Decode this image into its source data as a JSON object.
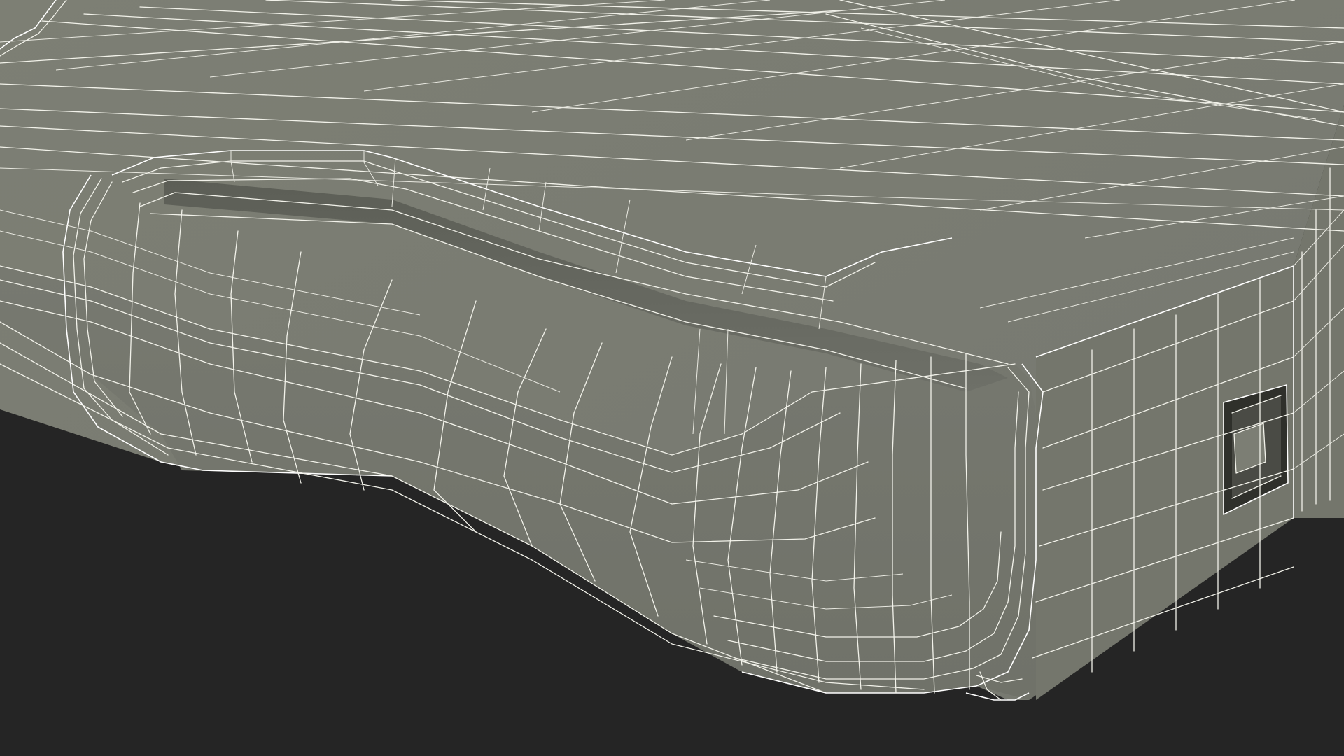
{
  "scene": {
    "subject": "3d-wireframe-device",
    "colors": {
      "background": "#252525",
      "surface_top": "#7b7d72",
      "surface_side": "#74766c",
      "surface_dark": "#5f6159",
      "port_inner": "#3a3b36",
      "wire": "#f2f2ea"
    }
  }
}
